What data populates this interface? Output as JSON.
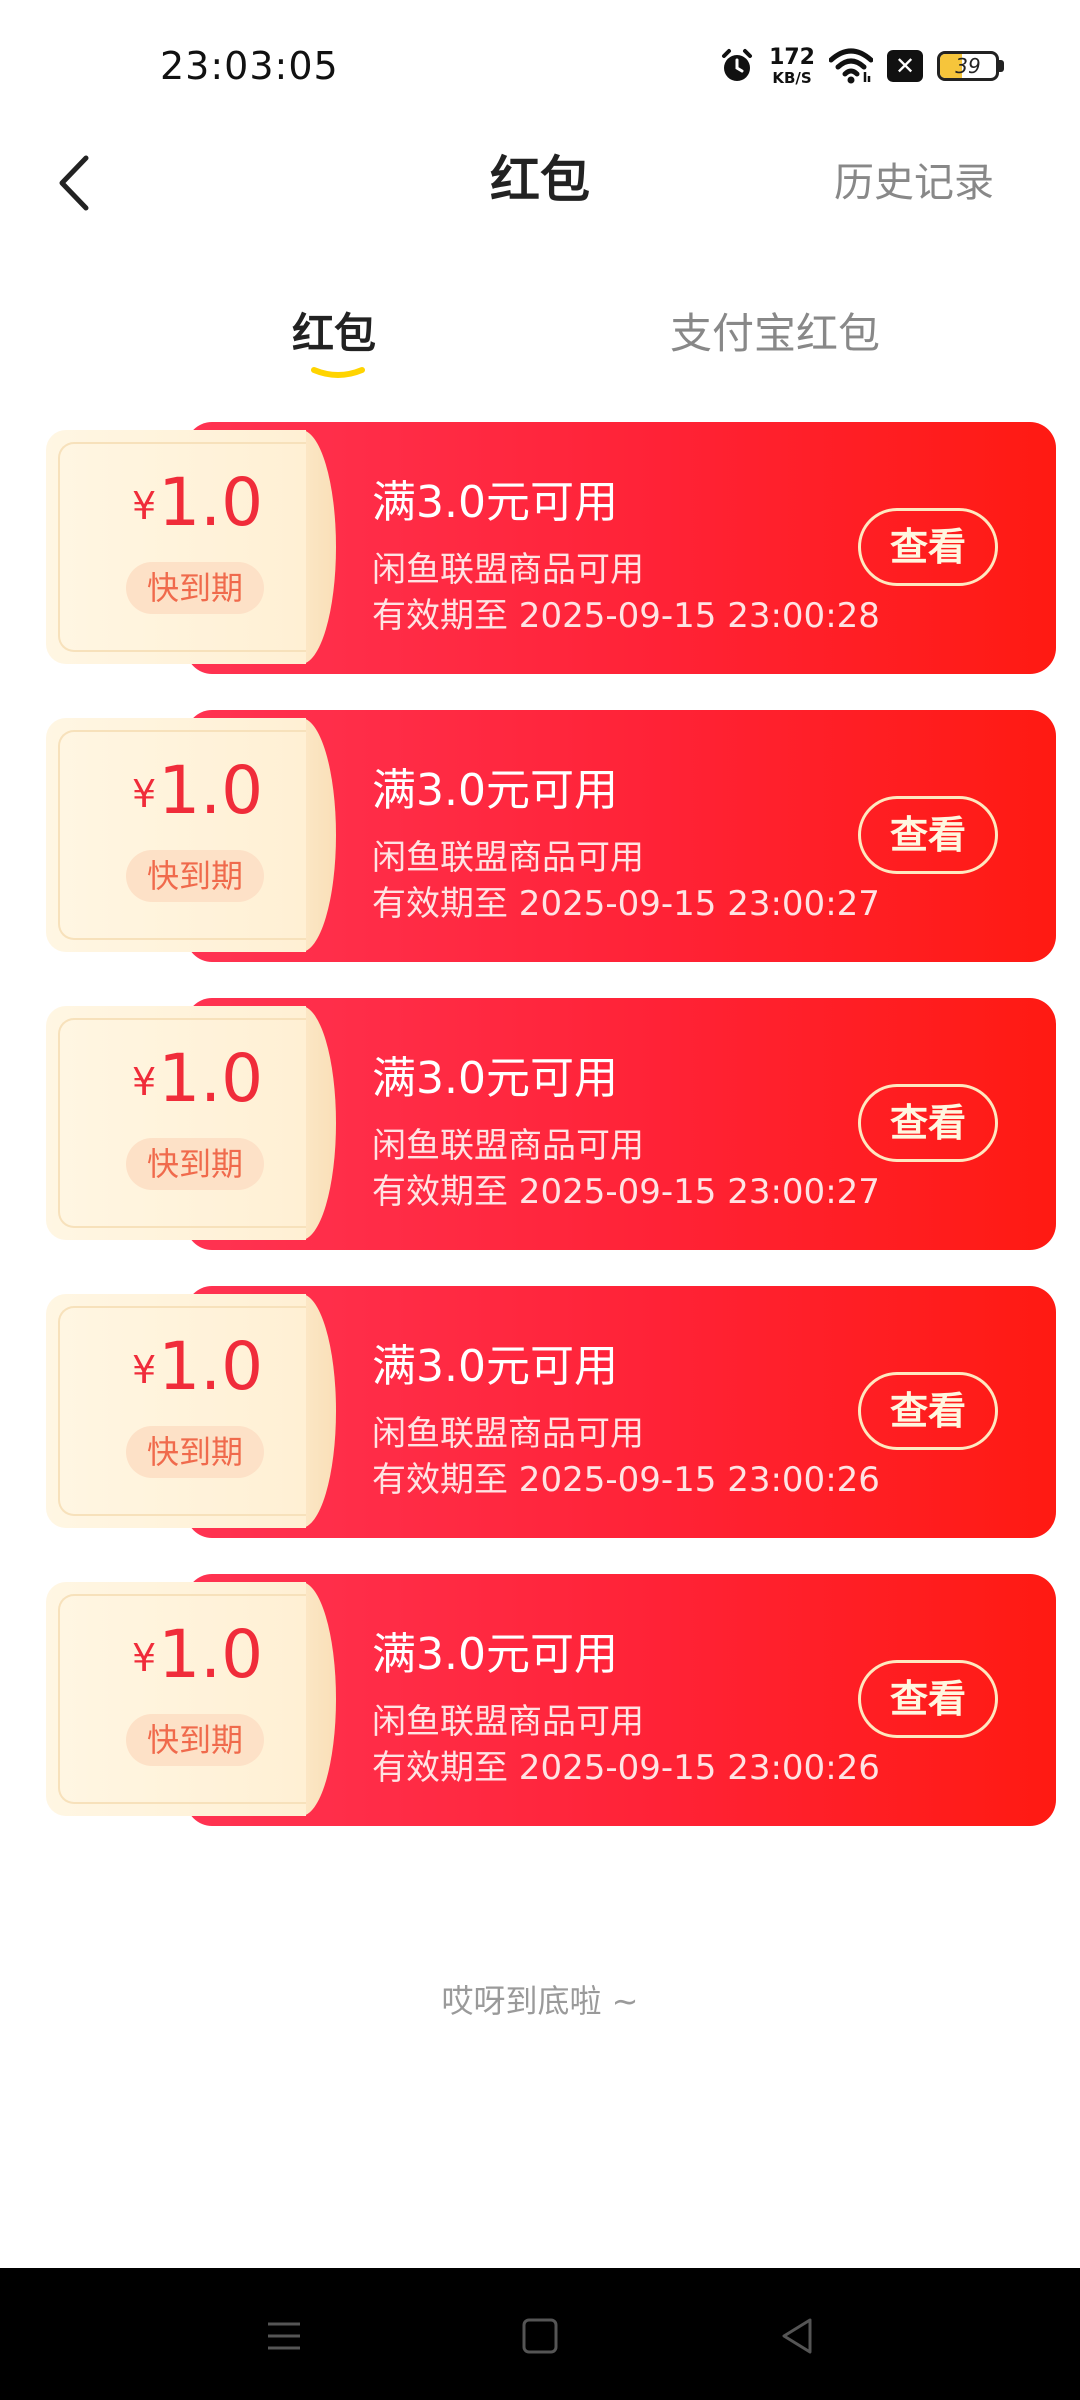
{
  "status_bar": {
    "time": "23:03:05",
    "net_speed_value": "172",
    "net_speed_unit": "KB/S",
    "battery_percent": "39",
    "battery_level": 0.39,
    "icons": [
      "alarm-icon",
      "wifi-icon",
      "close-box-icon",
      "battery-icon"
    ]
  },
  "header": {
    "title": "红包",
    "history_label": "历史记录",
    "back_icon": "chevron-left-icon"
  },
  "tabs": [
    {
      "label": "红包",
      "active": true
    },
    {
      "label": "支付宝红包",
      "active": false
    }
  ],
  "colors": {
    "accent_red": "#ff2236",
    "tab_underline": "#ffd400",
    "coupon_amount": "#f02c3a"
  },
  "coupons": [
    {
      "currency": "¥",
      "amount": "1.0",
      "badge": "快到期",
      "title": "满3.0元可用",
      "subtitle": "闲鱼联盟商品可用",
      "expiry": "有效期至 2025-09-15 23:00:28",
      "button": "查看"
    },
    {
      "currency": "¥",
      "amount": "1.0",
      "badge": "快到期",
      "title": "满3.0元可用",
      "subtitle": "闲鱼联盟商品可用",
      "expiry": "有效期至 2025-09-15 23:00:27",
      "button": "查看"
    },
    {
      "currency": "¥",
      "amount": "1.0",
      "badge": "快到期",
      "title": "满3.0元可用",
      "subtitle": "闲鱼联盟商品可用",
      "expiry": "有效期至 2025-09-15 23:00:27",
      "button": "查看"
    },
    {
      "currency": "¥",
      "amount": "1.0",
      "badge": "快到期",
      "title": "满3.0元可用",
      "subtitle": "闲鱼联盟商品可用",
      "expiry": "有效期至 2025-09-15 23:00:26",
      "button": "查看"
    },
    {
      "currency": "¥",
      "amount": "1.0",
      "badge": "快到期",
      "title": "满3.0元可用",
      "subtitle": "闲鱼联盟商品可用",
      "expiry": "有效期至 2025-09-15 23:00:26",
      "button": "查看"
    }
  ],
  "end_text": "哎呀到底啦 ~",
  "nav_bar": {
    "icons": [
      "menu-icon",
      "home-square-icon",
      "back-triangle-icon"
    ]
  }
}
